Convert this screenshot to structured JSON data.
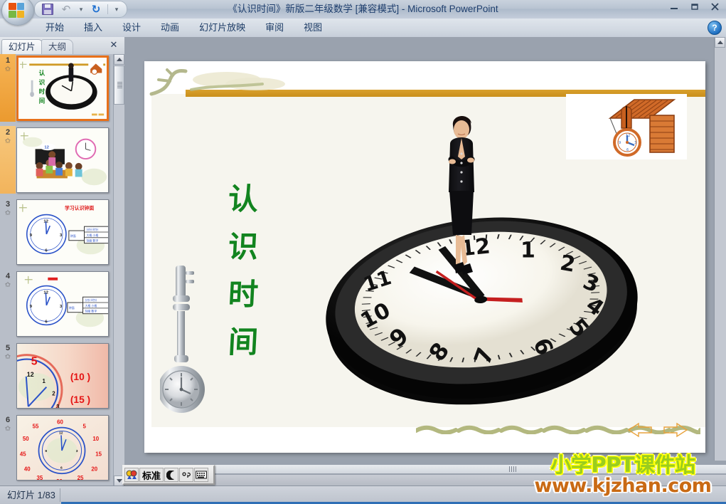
{
  "window": {
    "title": "《认识时间》新版二年级数学 [兼容模式] - Microsoft PowerPoint",
    "app_name": "Microsoft PowerPoint",
    "minimize_label": "最小化",
    "restore_label": "还原",
    "close_label": "关闭"
  },
  "quick_access": {
    "office_button": "Office 按钮",
    "save_label": "保存",
    "undo_label": "撤消",
    "undo_caret": "▾",
    "redo_label": "恢复",
    "customize_label": "▾"
  },
  "ribbon": {
    "tabs": [
      {
        "label": "开始"
      },
      {
        "label": "插入"
      },
      {
        "label": "设计"
      },
      {
        "label": "动画"
      },
      {
        "label": "幻灯片放映"
      },
      {
        "label": "审阅"
      },
      {
        "label": "视图"
      }
    ],
    "help_label": "?"
  },
  "pane": {
    "tabs": [
      {
        "label": "幻灯片",
        "active": true
      },
      {
        "label": "大纲",
        "active": false
      }
    ],
    "close_label": "✕",
    "thumbnails": [
      {
        "number": "1",
        "star": "✩",
        "selected": true,
        "alt": "认识时间 标题页 大时钟与女士"
      },
      {
        "number": "2",
        "star": "✩",
        "selected": false,
        "alt": "教室上课场景与粉色时钟"
      },
      {
        "number": "3",
        "star": "✩",
        "selected": false,
        "alt": "学习认识钟面 蓝色时钟与表格"
      },
      {
        "number": "4",
        "star": "✩",
        "selected": false,
        "alt": "钟面与表格"
      },
      {
        "number": "5",
        "star": "✩",
        "selected": false,
        "alt": "放大钟面 5 (10) (15)"
      },
      {
        "number": "6",
        "star": "✩",
        "selected": false,
        "alt": "钟面分钟刻度 5 10 15 20 25 30 35 40 45 50 55 60"
      }
    ]
  },
  "slide": {
    "title_chars": [
      "认",
      "识",
      "时",
      "间"
    ],
    "title_color": "#12841f",
    "accent_bar_color": "#d09a26",
    "background_color": "#f6f5ee",
    "objects": [
      {
        "name": "pendulum-clock",
        "alt": "银色挂钟摆"
      },
      {
        "name": "house-clock",
        "alt": "橙色小屋布谷钟"
      },
      {
        "name": "big-wall-clock",
        "alt": "黑色大挂钟"
      },
      {
        "name": "woman-figure",
        "alt": "黑色职业装女士"
      },
      {
        "name": "nav-arrows",
        "alt": "左右导航箭头"
      }
    ],
    "clock": {
      "hours": [
        "12",
        "1",
        "2",
        "3",
        "4",
        "5",
        "6",
        "7",
        "8",
        "9",
        "10",
        "11"
      ],
      "hand_color": "#111111",
      "second_hand_color": "#cc1a1a",
      "face_color": "#f8f6ef",
      "bezel_color": "#141414"
    }
  },
  "ime": {
    "logo_label": "中文输入法",
    "mode_label": "标准",
    "shape_label": "半角",
    "punct_label": "中文标点",
    "keyboard_label": "软键盘"
  },
  "status": {
    "slide_counter": "幻灯片 1/83"
  },
  "watermark": {
    "line1": "小学PPT课件站",
    "line2": "www.kjzhan.com",
    "line1_color": "#9acd1f",
    "line2_color": "#c96a14"
  },
  "scrollbars": {
    "up_arrow": "▲",
    "down_arrow": "▼",
    "right_arrow": "▶"
  }
}
